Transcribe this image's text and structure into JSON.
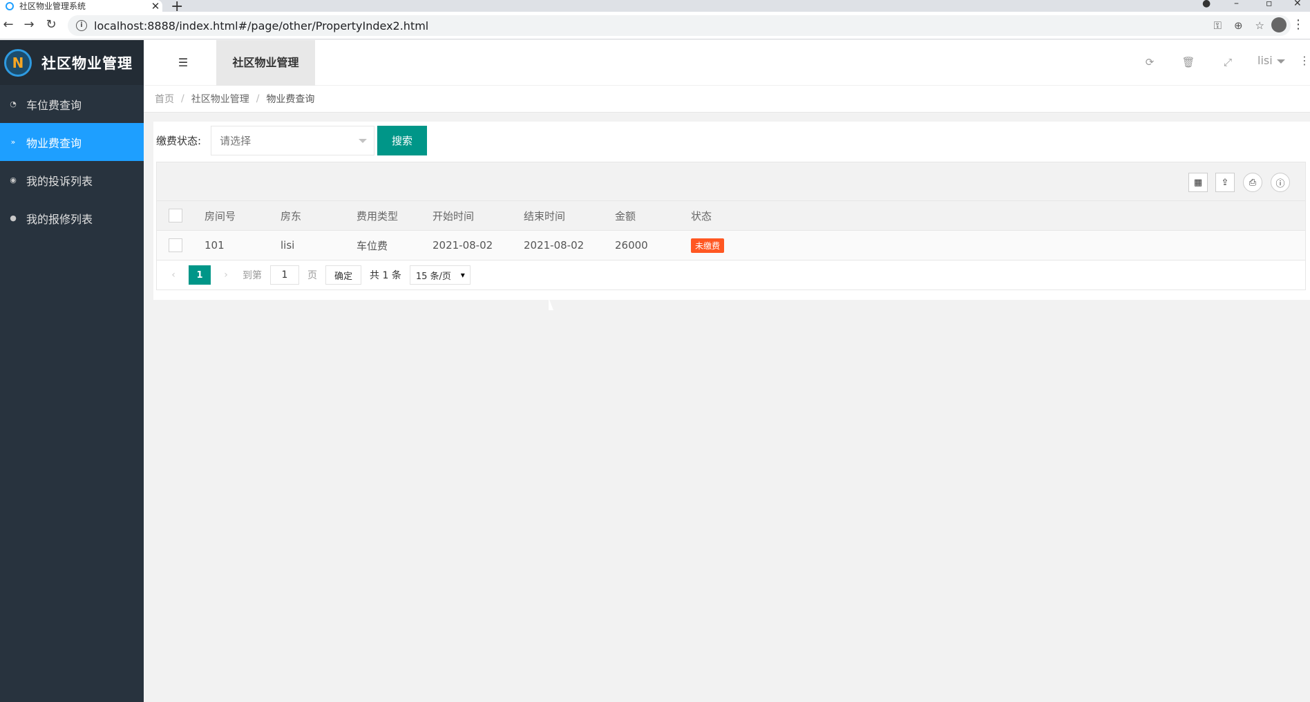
{
  "browser": {
    "tab_title": "社区物业管理系统",
    "url": "localhost:8888/index.html#/page/other/PropertyIndex2.html"
  },
  "app": {
    "logo_text": "社区物业管理",
    "sidebar": {
      "items": [
        {
          "label": "车位费查询",
          "icon": "dashboard-icon"
        },
        {
          "label": "物业费查询",
          "icon": "chevrons-down-icon",
          "active": true
        },
        {
          "label": "我的投诉列表",
          "icon": "target-icon"
        },
        {
          "label": "我的报修列表",
          "icon": "globe-icon"
        }
      ]
    },
    "topbar": {
      "tab_label": "社区物业管理",
      "user_name": "lisi"
    },
    "breadcrumb": [
      "首页",
      "社区物业管理",
      "物业费查询"
    ],
    "search": {
      "label": "缴费状态:",
      "select_placeholder": "请选择",
      "button_label": "搜索"
    },
    "table": {
      "columns": [
        "房间号",
        "房东",
        "费用类型",
        "开始时间",
        "结束时间",
        "金额",
        "状态"
      ],
      "rows": [
        {
          "room": "101",
          "owner": "lisi",
          "fee_type": "车位费",
          "start": "2021-08-02",
          "end": "2021-08-02",
          "amount": "26000",
          "status": "未缴费"
        }
      ]
    },
    "pager": {
      "current": "1",
      "goto_label": "到第",
      "page_input": "1",
      "page_unit": "页",
      "ok_label": "确定",
      "total": "共 1 条",
      "limit": "15 条/页"
    },
    "colors": {
      "sidebar_bg": "#28333e",
      "active_blue": "#1e9fff",
      "primary_green": "#009688",
      "danger_orange": "#ff5722"
    }
  }
}
